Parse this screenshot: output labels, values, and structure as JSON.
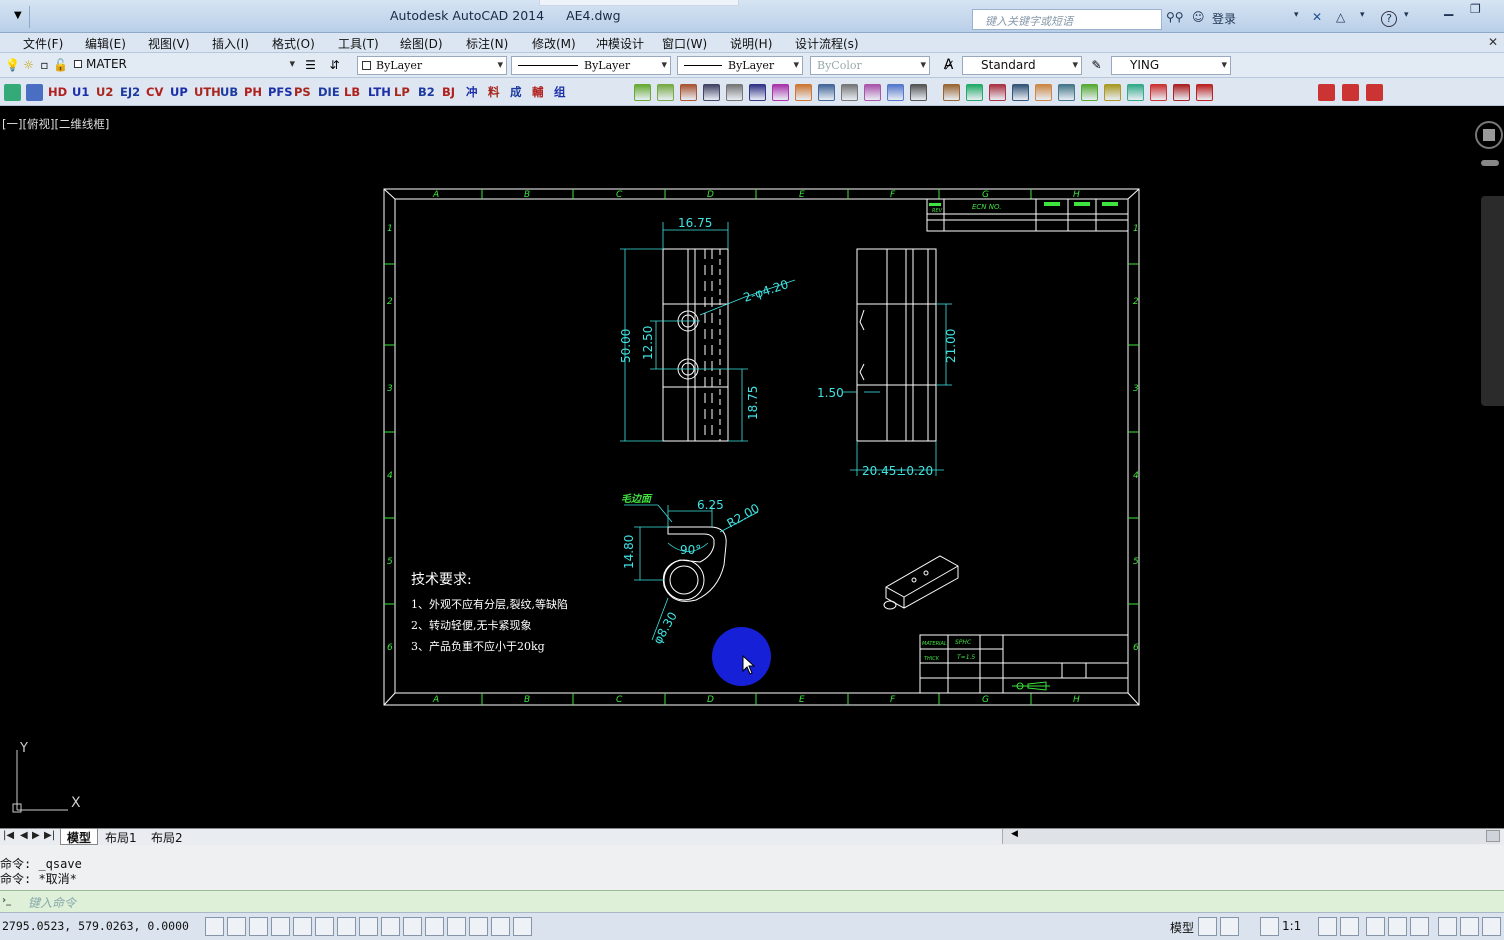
{
  "titlebar": {
    "app": "Autodesk AutoCAD 2014",
    "file": "AE4.dwg",
    "search_placeholder": "键入关键字或短语",
    "login": "登录",
    "help": "?"
  },
  "menu": [
    "文件(F)",
    "编辑(E)",
    "视图(V)",
    "插入(I)",
    "格式(O)",
    "工具(T)",
    "绘图(D)",
    "标注(N)",
    "修改(M)",
    "冲模设计",
    "窗口(W)",
    "说明(H)",
    "设计流程(s)"
  ],
  "toolbar1": {
    "layer": "MATER",
    "color": "ByLayer",
    "linetype": "ByLayer",
    "lineweight": "ByLayer",
    "plotstyle": "ByColor",
    "textstyle": "Standard",
    "dimstyle": "YING"
  },
  "toolbar2_labels": [
    "HD",
    "U1",
    "U2",
    "EJ2",
    "CV",
    "UP",
    "UTH",
    "UB",
    "PH",
    "PFS",
    "PS",
    "DIE",
    "LB",
    "LTH",
    "LP",
    "B2",
    "BJ",
    "冲",
    "料",
    "成",
    "輔",
    "组"
  ],
  "viewport_label": "[一][俯视][二维线框]",
  "drawing": {
    "grid_cols": [
      "A",
      "B",
      "C",
      "D",
      "E",
      "F",
      "G",
      "H"
    ],
    "grid_rows": [
      "1",
      "2",
      "3",
      "4",
      "5",
      "6"
    ],
    "title_header": {
      "rev": "REV",
      "ecn": "ECN NO."
    },
    "dims": {
      "d1": "16.75",
      "d2": "2-φ4.20",
      "d3": "50.00",
      "d4": "12.50",
      "d5": "18.75",
      "d6": "21.00",
      "d7": "1.50",
      "d8": "20.45±0.20",
      "d9": "6.25",
      "d10": "R2.00",
      "d11": "90°",
      "d12": "14.80",
      "d13": "φ8.30",
      "burr": "毛边面"
    },
    "notes": {
      "title": "技术要求:",
      "n1": "1、外观不应有分层,裂纹,等缺陷",
      "n2": "2、转动轻便,无卡紧现象",
      "n3": "3、产品负重不应小于20kg"
    },
    "titleblock": {
      "material": "MATERIAL",
      "material_val": "SPHC",
      "thick": "THICK",
      "thick_val": "T=1.5"
    }
  },
  "ucs": {
    "x": "X",
    "y": "Y"
  },
  "tabs": {
    "model": "模型",
    "layout1": "布局1",
    "layout2": "布局2"
  },
  "command": {
    "line1": "命令: _qsave",
    "line2": "命令: *取消*",
    "placeholder": "键入命令"
  },
  "status": {
    "coords": "2795.0523, 579.0263, 0.0000",
    "model": "模型",
    "scale": "1:1"
  }
}
